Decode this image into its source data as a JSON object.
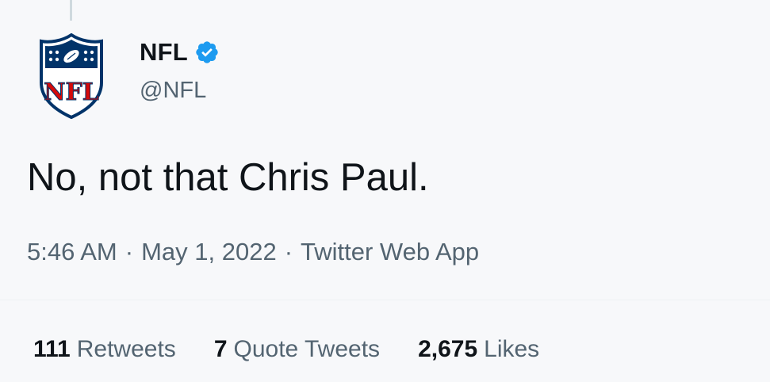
{
  "author": {
    "display_name": "NFL",
    "handle": "@NFL",
    "verified": true,
    "avatar_icon": "nfl-shield-logo",
    "brand_colors": {
      "navy": "#013369",
      "red": "#d50a0a",
      "white": "#ffffff"
    }
  },
  "tweet": {
    "text": "No, not that Chris Paul.",
    "time": "5:46 AM",
    "date": "May 1, 2022",
    "source": "Twitter Web App",
    "separator": "·"
  },
  "stats": {
    "retweets": {
      "count": "111",
      "label": "Retweets"
    },
    "quote_tweets": {
      "count": "7",
      "label": "Quote Tweets"
    },
    "likes": {
      "count": "2,675",
      "label": "Likes"
    }
  },
  "colors": {
    "verified": "#1d9bf0",
    "secondary_text": "#536471",
    "primary_text": "#0f1419",
    "background": "#f7f8fa"
  },
  "icons": {
    "verified": "verified-badge-icon"
  }
}
